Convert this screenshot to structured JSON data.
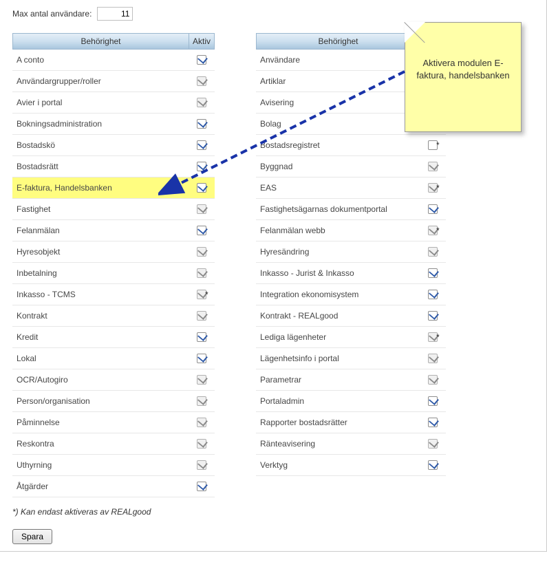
{
  "max_users_label": "Max antal användare:",
  "max_users_value": "11",
  "headers": {
    "behorighet": "Behörighet",
    "aktiv": "Aktiv"
  },
  "left_rows": [
    {
      "id": "a-conto",
      "label": "A conto",
      "checked": true,
      "disabled": false,
      "star": false
    },
    {
      "id": "anvandargrupper",
      "label": "Användargrupper/roller",
      "checked": true,
      "disabled": true,
      "star": false
    },
    {
      "id": "avier-portal",
      "label": "Avier i portal",
      "checked": true,
      "disabled": true,
      "star": false
    },
    {
      "id": "bokningsadmin",
      "label": "Bokningsadministration",
      "checked": true,
      "disabled": false,
      "star": false
    },
    {
      "id": "bostadsko",
      "label": "Bostadskö",
      "checked": true,
      "disabled": false,
      "star": false
    },
    {
      "id": "bostadsratt",
      "label": "Bostadsrätt",
      "checked": true,
      "disabled": false,
      "star": false
    },
    {
      "id": "e-faktura",
      "label": "E-faktura, Handelsbanken",
      "checked": true,
      "disabled": false,
      "star": false,
      "highlight": true
    },
    {
      "id": "fastighet",
      "label": "Fastighet",
      "checked": true,
      "disabled": true,
      "star": false
    },
    {
      "id": "felanmalan",
      "label": "Felanmälan",
      "checked": true,
      "disabled": false,
      "star": false
    },
    {
      "id": "hyresobjekt",
      "label": "Hyresobjekt",
      "checked": true,
      "disabled": true,
      "star": false
    },
    {
      "id": "inbetalning",
      "label": "Inbetalning",
      "checked": true,
      "disabled": true,
      "star": false
    },
    {
      "id": "inkasso-tcms",
      "label": "Inkasso - TCMS",
      "checked": true,
      "disabled": true,
      "star": true
    },
    {
      "id": "kontrakt",
      "label": "Kontrakt",
      "checked": true,
      "disabled": true,
      "star": false
    },
    {
      "id": "kredit",
      "label": "Kredit",
      "checked": true,
      "disabled": false,
      "star": false
    },
    {
      "id": "lokal",
      "label": "Lokal",
      "checked": true,
      "disabled": false,
      "star": false
    },
    {
      "id": "ocr-autogiro",
      "label": "OCR/Autogiro",
      "checked": true,
      "disabled": true,
      "star": false
    },
    {
      "id": "person-org",
      "label": "Person/organisation",
      "checked": true,
      "disabled": true,
      "star": false
    },
    {
      "id": "paminnelse",
      "label": "Påminnelse",
      "checked": true,
      "disabled": true,
      "star": false
    },
    {
      "id": "reskontra",
      "label": "Reskontra",
      "checked": true,
      "disabled": true,
      "star": false
    },
    {
      "id": "uthyrning",
      "label": "Uthyrning",
      "checked": true,
      "disabled": true,
      "star": false
    },
    {
      "id": "atgarder",
      "label": "Åtgärder",
      "checked": true,
      "disabled": false,
      "star": false
    }
  ],
  "right_rows": [
    {
      "id": "anvandare",
      "label": "Användare",
      "checked": true,
      "disabled": true,
      "star": false
    },
    {
      "id": "artiklar",
      "label": "Artiklar",
      "checked": true,
      "disabled": true,
      "star": false
    },
    {
      "id": "avisering",
      "label": "Avisering",
      "checked": true,
      "disabled": true,
      "star": false
    },
    {
      "id": "bolag",
      "label": "Bolag",
      "checked": true,
      "disabled": true,
      "star": false
    },
    {
      "id": "bostadsregistret",
      "label": "Bostadsregistret",
      "checked": false,
      "disabled": false,
      "star": true
    },
    {
      "id": "byggnad",
      "label": "Byggnad",
      "checked": true,
      "disabled": true,
      "star": false
    },
    {
      "id": "eas",
      "label": "EAS",
      "checked": true,
      "disabled": true,
      "star": true
    },
    {
      "id": "fastighetsagarnas",
      "label": "Fastighetsägarnas dokumentportal",
      "checked": true,
      "disabled": false,
      "star": false
    },
    {
      "id": "felanmalan-webb",
      "label": "Felanmälan webb",
      "checked": true,
      "disabled": true,
      "star": true
    },
    {
      "id": "hyresandring",
      "label": "Hyresändring",
      "checked": true,
      "disabled": true,
      "star": false
    },
    {
      "id": "inkasso-jurist",
      "label": "Inkasso - Jurist & Inkasso",
      "checked": true,
      "disabled": false,
      "star": false
    },
    {
      "id": "integration-ekonom",
      "label": "Integration ekonomisystem",
      "checked": true,
      "disabled": false,
      "star": false
    },
    {
      "id": "kontrakt-realgood",
      "label": "Kontrakt - REALgood",
      "checked": true,
      "disabled": false,
      "star": false
    },
    {
      "id": "lediga-lagenheter",
      "label": "Lediga lägenheter",
      "checked": true,
      "disabled": true,
      "star": true
    },
    {
      "id": "lagenhetsinfo",
      "label": "Lägenhetsinfo i portal",
      "checked": true,
      "disabled": true,
      "star": false
    },
    {
      "id": "parametrar",
      "label": "Parametrar",
      "checked": true,
      "disabled": true,
      "star": false
    },
    {
      "id": "portaladmin",
      "label": "Portaladmin",
      "checked": true,
      "disabled": false,
      "star": false
    },
    {
      "id": "rapporter-bostadsratter",
      "label": "Rapporter bostadsrätter",
      "checked": true,
      "disabled": false,
      "star": false
    },
    {
      "id": "ranteavisering",
      "label": "Ränteavisering",
      "checked": true,
      "disabled": true,
      "star": false
    },
    {
      "id": "verktyg",
      "label": "Verktyg",
      "checked": true,
      "disabled": false,
      "star": false
    }
  ],
  "footnote": "*) Kan endast aktiveras av REALgood",
  "save_label": "Spara",
  "callout_text": "Aktivera modulen E-faktura, handelsbanken"
}
